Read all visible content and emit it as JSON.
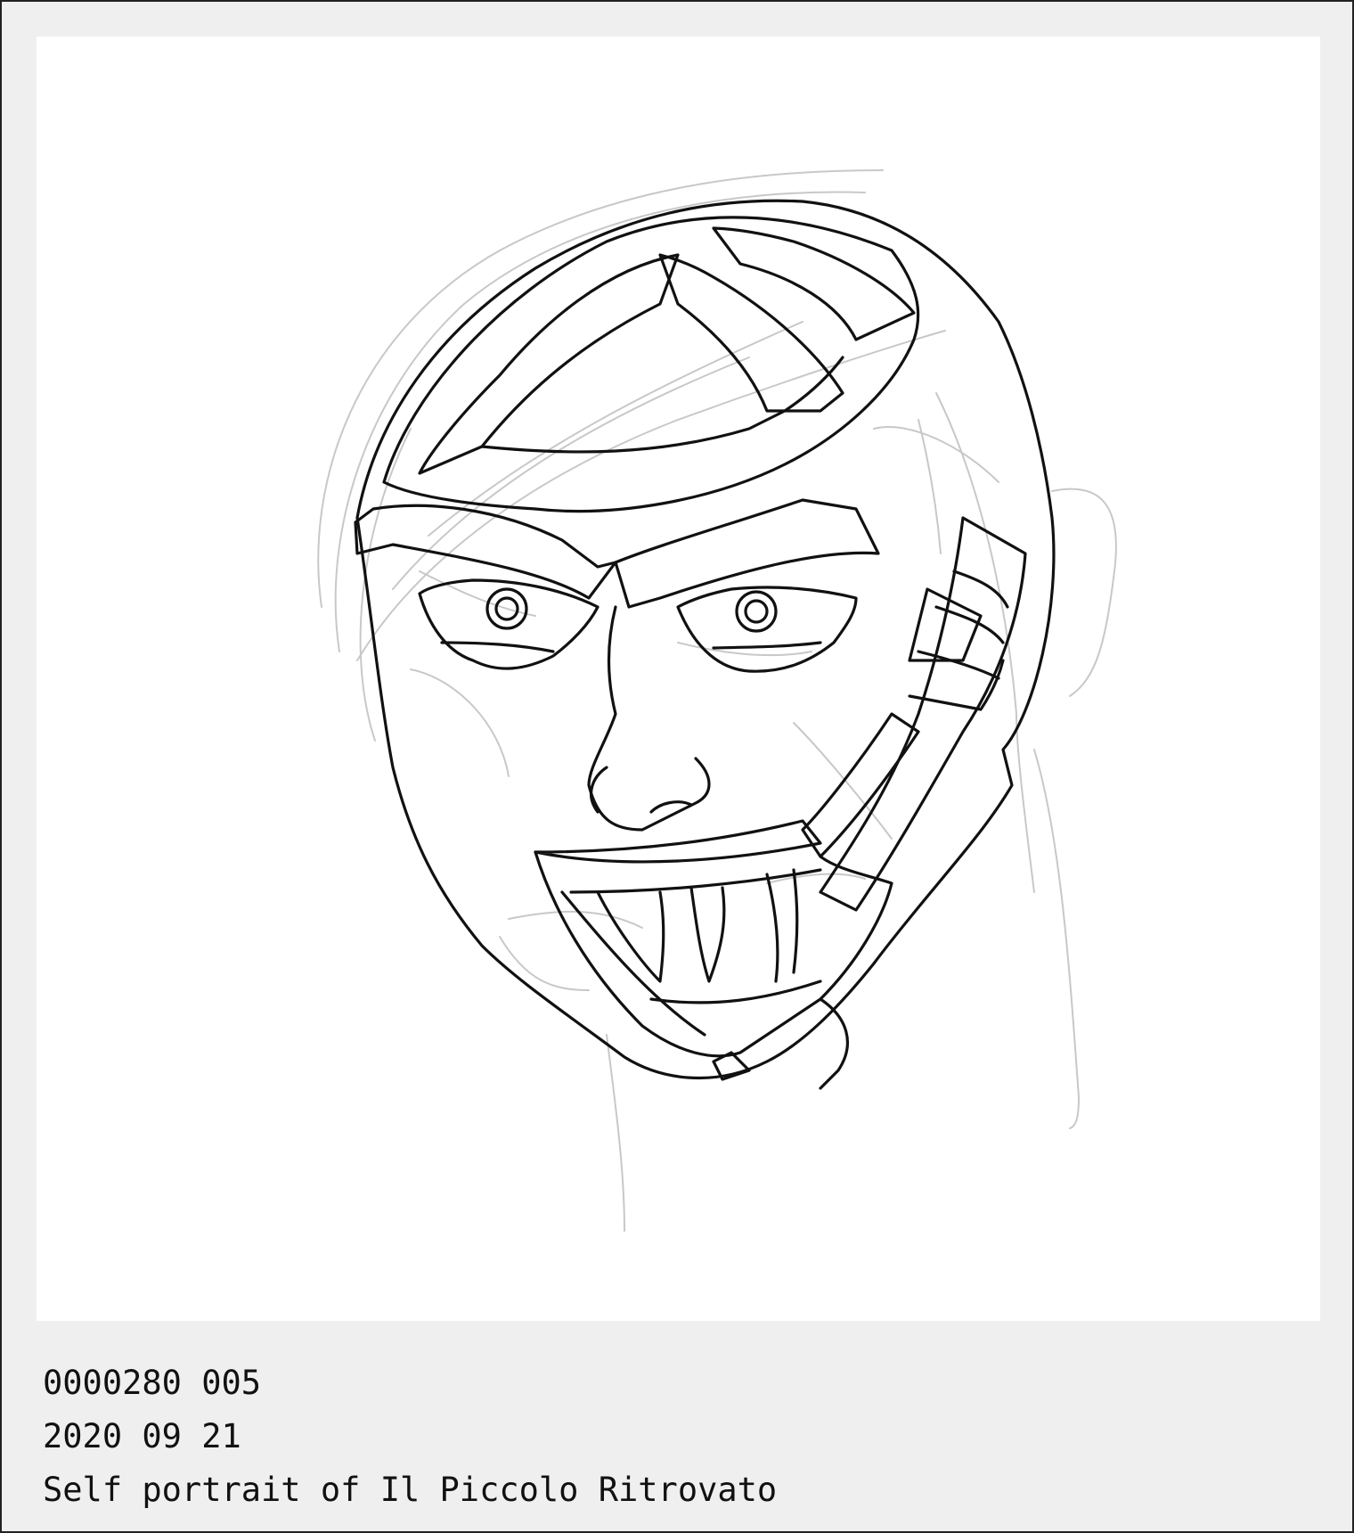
{
  "artwork": {
    "name": "self-portrait-line-drawing",
    "stroke_main": "#111111",
    "stroke_sketch": "#c8c8c8",
    "background": "#ffffff",
    "frame_color": "#efefef"
  },
  "caption": {
    "catalog_number": "0000280 005",
    "date": "2020 09 21",
    "title": "Self portrait of Il Piccolo Ritrovato"
  }
}
